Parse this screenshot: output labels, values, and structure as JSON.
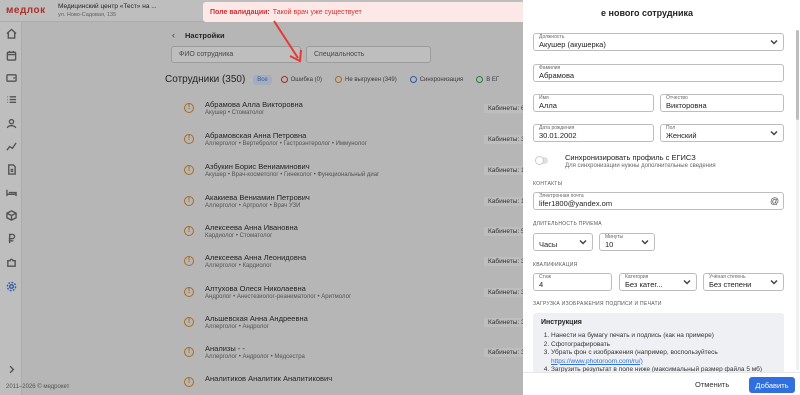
{
  "app": {
    "logo": "медлок",
    "clinic_name": "Медицинский центр «Тест» на ...",
    "clinic_address": "ул. Ново-Садовая, 135"
  },
  "settings": {
    "back_icon": "chevron-left-icon",
    "title": "Настройки"
  },
  "filters": {
    "name_placeholder": "ФИО сотрудника",
    "specialty_placeholder": "Специальность"
  },
  "list": {
    "title": "Сотрудники (350)",
    "chips": [
      {
        "label": "Все",
        "color": "#2f6fe0"
      },
      {
        "label": "Ошибка (0)",
        "color": "#d32f2f"
      },
      {
        "label": "Не выгружен (349)",
        "color": "#e08a1e"
      },
      {
        "label": "Синхронизация",
        "color": "#2f6fe0"
      },
      {
        "label": "В ЕГ",
        "color": "#2e9e4f"
      }
    ],
    "rows": [
      {
        "name": "Абрамова Алла Викторовна",
        "spec": "Акушер • Стоматолог",
        "cab": "Кабинеты: 6"
      },
      {
        "name": "Абрамовская Анна Петровна",
        "spec": "Аллерголог • Вертебролог • Гастроэнтеролог • Иммунолог",
        "cab": "Кабинеты: 3"
      },
      {
        "name": "Азбукин Борис Вениаминович",
        "spec": "Акушер • Врач-косметолог • Гинеколог • Функциональный диаг",
        "cab": "Кабинеты: 10"
      },
      {
        "name": "Акакиева Вениамин Петрович",
        "spec": "Аллерголог • Артролог • Врач УЗИ",
        "cab": "Кабинеты: 12"
      },
      {
        "name": "Алексеева Анна Ивановна",
        "spec": "Кардиолог • Стоматолог",
        "cab": "Кабинеты: 5"
      },
      {
        "name": "Алексеева Анна Леонидовна",
        "spec": "Аллерголог • Кардиолог",
        "cab": "Кабинеты: 3"
      },
      {
        "name": "Алтухова Олеся Николаевна",
        "spec": "Андролог • Анестезиолог-реаниматолог • Аритмолог",
        "cab": "Кабинеты: 3"
      },
      {
        "name": "Альшевская Анна Андреевна",
        "spec": "Аллерголог • Андролог",
        "cab": "Кабинеты: 3"
      },
      {
        "name": "Анализы - -",
        "spec": "Аллерголог • Андролог • Медсестра",
        "cab": "Кабинеты: 3"
      },
      {
        "name": "Аналитиков Аналитик Аналитикович",
        "spec": "",
        "cab": ""
      }
    ]
  },
  "footer": {
    "copyright": "2011–2026 © медрокет"
  },
  "toast": {
    "label": "Поле валидации:",
    "message": "Такой врач уже существует",
    "close_icon": "close-icon"
  },
  "drawer": {
    "title": "Добавление нового сотрудника",
    "visible_title": "е нового сотрудника",
    "fields": {
      "position": {
        "label": "Должность",
        "value": "Акушер (акушерка)"
      },
      "last_name": {
        "label": "Фамилия",
        "value": "Абрамова"
      },
      "first_name": {
        "label": "Имя",
        "value": "Алла"
      },
      "patronymic": {
        "label": "Отчество",
        "value": "Викторовна"
      },
      "birth_date": {
        "label": "Дата рождения",
        "value": "30.01.2002"
      },
      "gender": {
        "label": "Пол",
        "value": "Женский"
      },
      "email": {
        "label": "Электронная почта",
        "value": "lifer1800@yandex.om"
      },
      "hours": {
        "value": "Часы"
      },
      "minutes": {
        "label": "Минуты",
        "value": "10"
      },
      "experience": {
        "label": "Стаж",
        "value": "4"
      },
      "category": {
        "label": "Категория",
        "value": "Без катег..."
      },
      "degree": {
        "label": "Учёная степень",
        "value": "Без степени"
      }
    },
    "sync": {
      "label": "Синхронизировать профиль с ЕГИСЗ",
      "hint": "Для синхронизации нужны дополнительные сведения"
    },
    "sections": {
      "contacts": "КОНТАКТЫ",
      "duration": "ДЛИТЕЛЬНОСТЬ ПРИЕМА",
      "qualification": "КВАЛИФИКАЦИЯ",
      "signature": "ЗАГРУЗКА ИЗОБРАЖЕНИЯ ПОДПИСИ И ПЕЧАТИ"
    },
    "instruction": {
      "heading": "Инструкция",
      "steps": [
        "Нанести на бумагу печать и подпись (как на примере)",
        "Сфотографировать",
        "Убрать фон с изображения (например, воспользуйтесь",
        "Загрузить результат в поле ниже (максимальный размер файла 5 мб)"
      ],
      "link": "https://www.photoroom.com/ru/)"
    },
    "cancel_label": "Отменить",
    "add_label": "Добавить"
  },
  "colors": {
    "accent": "#2f6fe0",
    "error": "#d32f2f",
    "warning": "#e08a1e",
    "brand": "#e2342b"
  }
}
